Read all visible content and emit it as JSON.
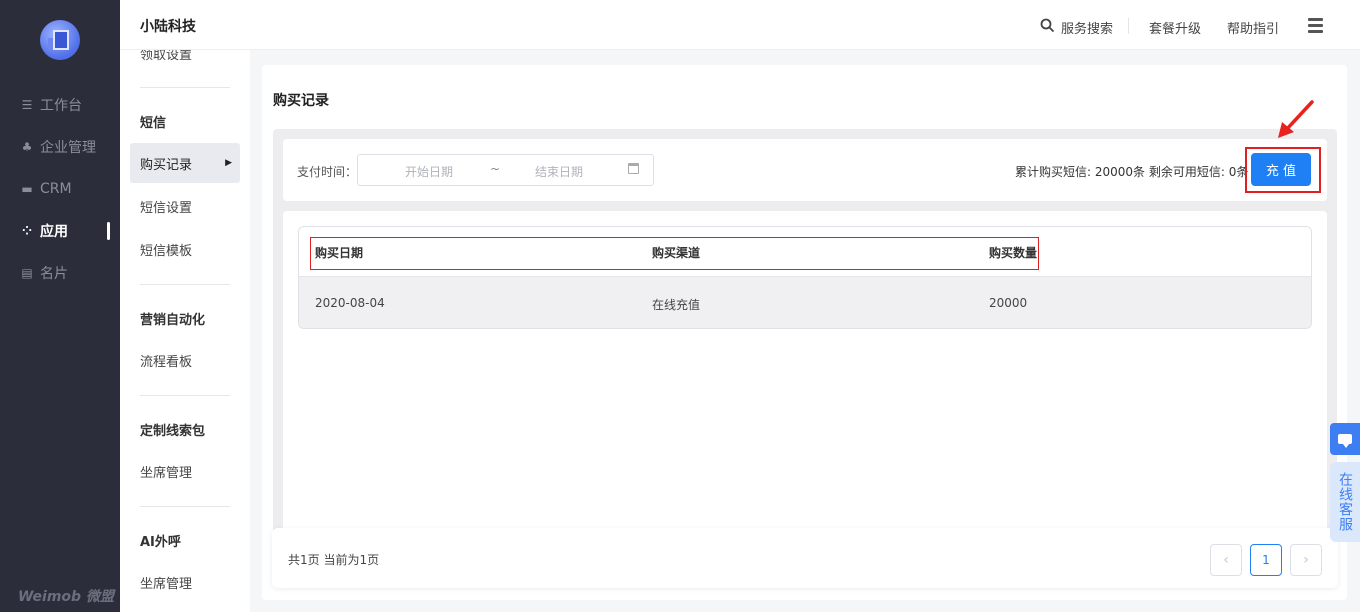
{
  "sidebar": {
    "items": [
      {
        "label": "工作台",
        "icon": "dashboard-icon"
      },
      {
        "label": "企业管理",
        "icon": "org-chart-icon"
      },
      {
        "label": "CRM",
        "icon": "crm-icon"
      },
      {
        "label": "应用",
        "icon": "apps-icon"
      },
      {
        "label": "名片",
        "icon": "business-card-icon"
      }
    ],
    "active": "应用",
    "footer_logo": "Weimob 微盟"
  },
  "header": {
    "company": "小陆科技",
    "links": {
      "search": "服务搜索",
      "upgrade": "套餐升级",
      "help": "帮助指引"
    }
  },
  "submenu": {
    "cut_item": "领取设置",
    "groups": [
      {
        "title": "短信",
        "items": [
          "购买记录",
          "短信设置",
          "短信模板"
        ]
      },
      {
        "title": "营销自动化",
        "items": [
          "流程看板"
        ]
      },
      {
        "title": "定制线索包",
        "items": [
          "坐席管理"
        ]
      },
      {
        "title": "AI外呼",
        "items": [
          "坐席管理"
        ]
      }
    ],
    "selected": "购买记录"
  },
  "main": {
    "title": "购买记录",
    "filter": {
      "label": "支付时间：",
      "start_placeholder": "开始日期",
      "separator": "~",
      "end_placeholder": "结束日期"
    },
    "stats_text": "累计购买短信: 20000条 剩余可用短信: 0条",
    "charge_button": "充 值",
    "table": {
      "columns": [
        "购买日期",
        "购买渠道",
        "购买数量"
      ],
      "rows": [
        [
          "2020-08-04",
          "在线充值",
          "20000"
        ]
      ]
    },
    "pagination": {
      "summary": "共1页 当前为1页",
      "current_page": "1",
      "prev": "‹",
      "next": "›"
    }
  },
  "service_widget": {
    "label": "在线客服"
  },
  "colors": {
    "primary": "#1f80f5",
    "highlight": "#e02020",
    "sidebar_bg": "#2b2d3a"
  }
}
